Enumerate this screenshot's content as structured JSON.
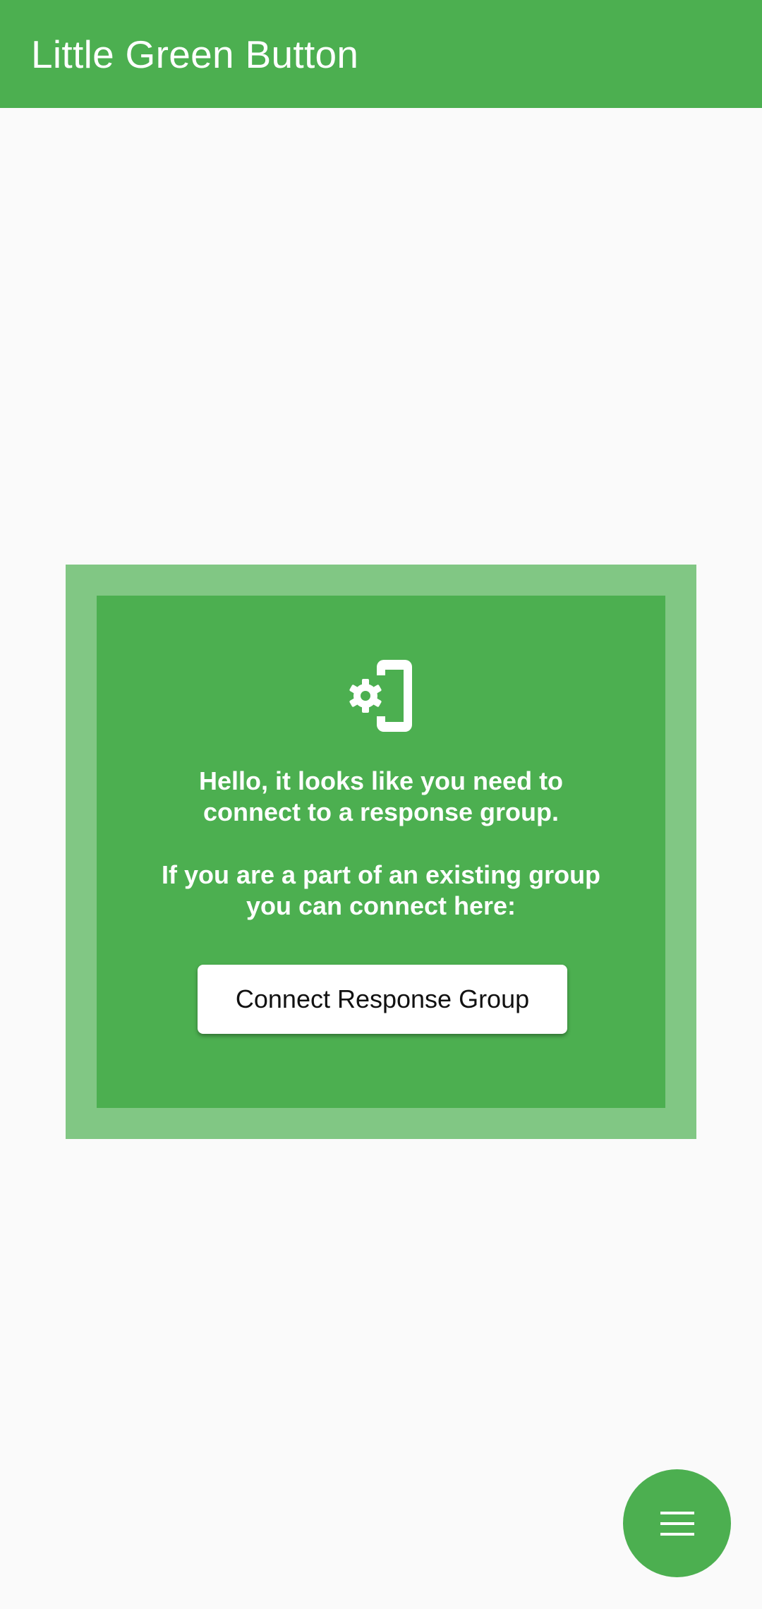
{
  "app_bar": {
    "title": "Little Green Button"
  },
  "prompt_card": {
    "icon": "phone-settings-icon",
    "message_line1": "Hello, it looks like you need to",
    "message_line2": "connect to a response group.",
    "message_line3": "If you are a part of an existing group",
    "message_line4": "you can connect here:",
    "button_label": "Connect Response Group"
  },
  "fab": {
    "icon": "menu-icon"
  },
  "colors": {
    "primary": "#4caf50",
    "primary_light": "#81c784",
    "background": "#fafafa",
    "on_primary": "#ffffff"
  }
}
